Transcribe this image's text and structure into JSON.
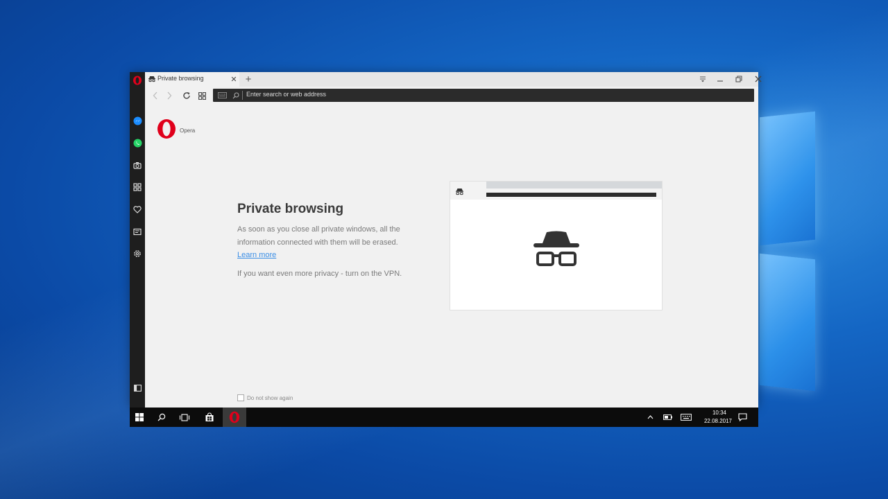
{
  "tab": {
    "title": "Private browsing",
    "close_symbol": "✕",
    "new_tab_symbol": "+"
  },
  "address_bar": {
    "placeholder": "Enter search or web address"
  },
  "sidebar": {
    "items": [
      "opera-logo-icon",
      "messenger-icon",
      "whatsapp-icon",
      "camera-icon",
      "speed-dial-icon",
      "heart-icon",
      "news-icon",
      "settings-icon",
      "sidebar-toggle-icon"
    ]
  },
  "page": {
    "brand": "Opera",
    "title": "Private browsing",
    "description": "As soon as you close all private windows, all the information connected with them will be erased.",
    "learn_more": "Learn more",
    "vpn_note": "If you want even more privacy - turn on the VPN.",
    "dont_show": "Do not show again"
  },
  "taskbar": {
    "time": "10:34",
    "date": "22.08.2017"
  },
  "colors": {
    "opera_red": "#e0001b",
    "link": "#3a8ee6",
    "messenger": "#1a8cff",
    "whatsapp": "#25d366"
  }
}
